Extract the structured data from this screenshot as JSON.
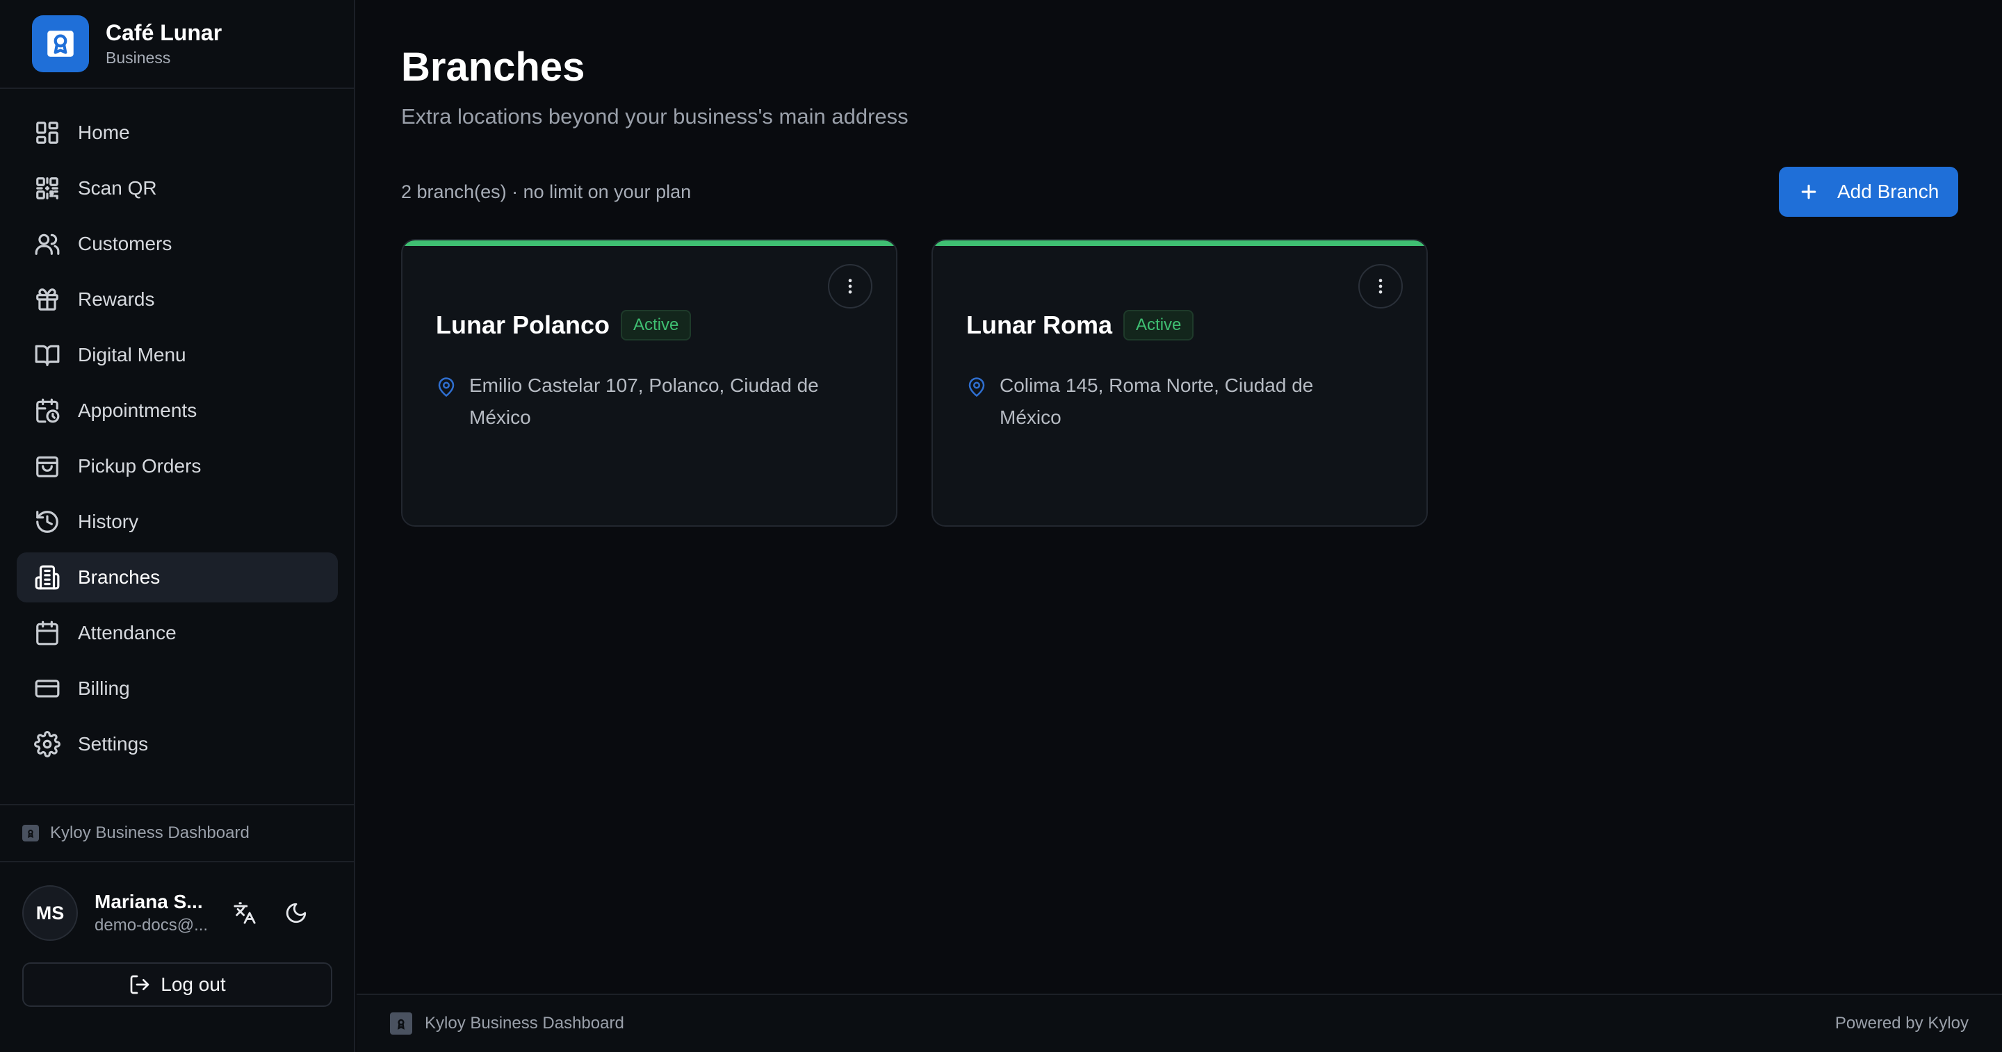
{
  "brand": {
    "name": "Café Lunar",
    "subtitle": "Business"
  },
  "nav": {
    "items": [
      {
        "label": "Home",
        "icon": "grid-icon"
      },
      {
        "label": "Scan QR",
        "icon": "qr-icon"
      },
      {
        "label": "Customers",
        "icon": "users-icon"
      },
      {
        "label": "Rewards",
        "icon": "gift-icon"
      },
      {
        "label": "Digital Menu",
        "icon": "book-icon"
      },
      {
        "label": "Appointments",
        "icon": "calendar-clock-icon"
      },
      {
        "label": "Pickup Orders",
        "icon": "shopping-bag-icon"
      },
      {
        "label": "History",
        "icon": "history-icon"
      },
      {
        "label": "Branches",
        "icon": "building-icon",
        "active": true
      },
      {
        "label": "Attendance",
        "icon": "calendar-icon"
      },
      {
        "label": "Billing",
        "icon": "credit-card-icon"
      },
      {
        "label": "Settings",
        "icon": "gear-icon"
      }
    ]
  },
  "sidebar_footer": {
    "label": "Kyloy Business Dashboard"
  },
  "user": {
    "initials": "MS",
    "name": "Mariana S...",
    "email": "demo-docs@...",
    "logout_label": "Log out"
  },
  "page": {
    "title": "Branches",
    "subtitle": "Extra locations beyond your business's main address",
    "count_text": "2 branch(es) · no limit on your plan",
    "add_button": "Add Branch"
  },
  "branches": [
    {
      "name": "Lunar Polanco",
      "status": "Active",
      "address": "Emilio Castelar 107, Polanco, Ciudad de México"
    },
    {
      "name": "Lunar Roma",
      "status": "Active",
      "address": "Colima 145, Roma Norte, Ciudad de México"
    }
  ],
  "footer": {
    "left": "Kyloy Business Dashboard",
    "right": "Powered by Kyloy"
  },
  "colors": {
    "accent": "#1f6fd8",
    "active_status": "#3fbf72",
    "background": "#090b0f"
  }
}
